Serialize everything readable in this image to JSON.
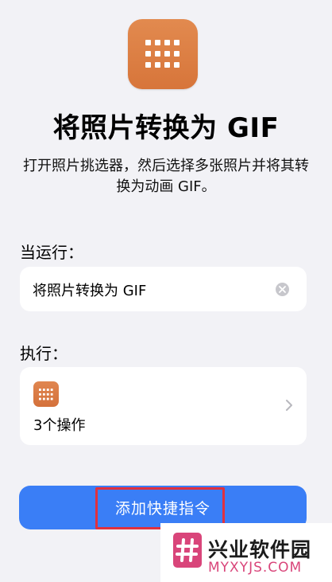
{
  "header": {
    "icon": "grid-icon",
    "title": "将照片转换为 GIF",
    "description": "打开照片挑选器，然后选择多张照片并将其转换为动画 GIF。"
  },
  "trigger": {
    "label": "当运行：",
    "value": "将照片转换为 GIF",
    "clear_icon": "clear-icon"
  },
  "actions": {
    "label": "执行：",
    "icon": "grid-icon",
    "summary": "3个操作",
    "chevron_icon": "chevron-right-icon"
  },
  "button": {
    "label": "添加快捷指令",
    "color": "#3a7ef6"
  },
  "watermark": {
    "name": "兴业软件园",
    "domain": "MYXYJS.COM",
    "accent": "#d9457a"
  },
  "colors": {
    "icon_orange": "#dd7f45",
    "background": "#f2f2f6",
    "highlight": "#e0313e"
  }
}
